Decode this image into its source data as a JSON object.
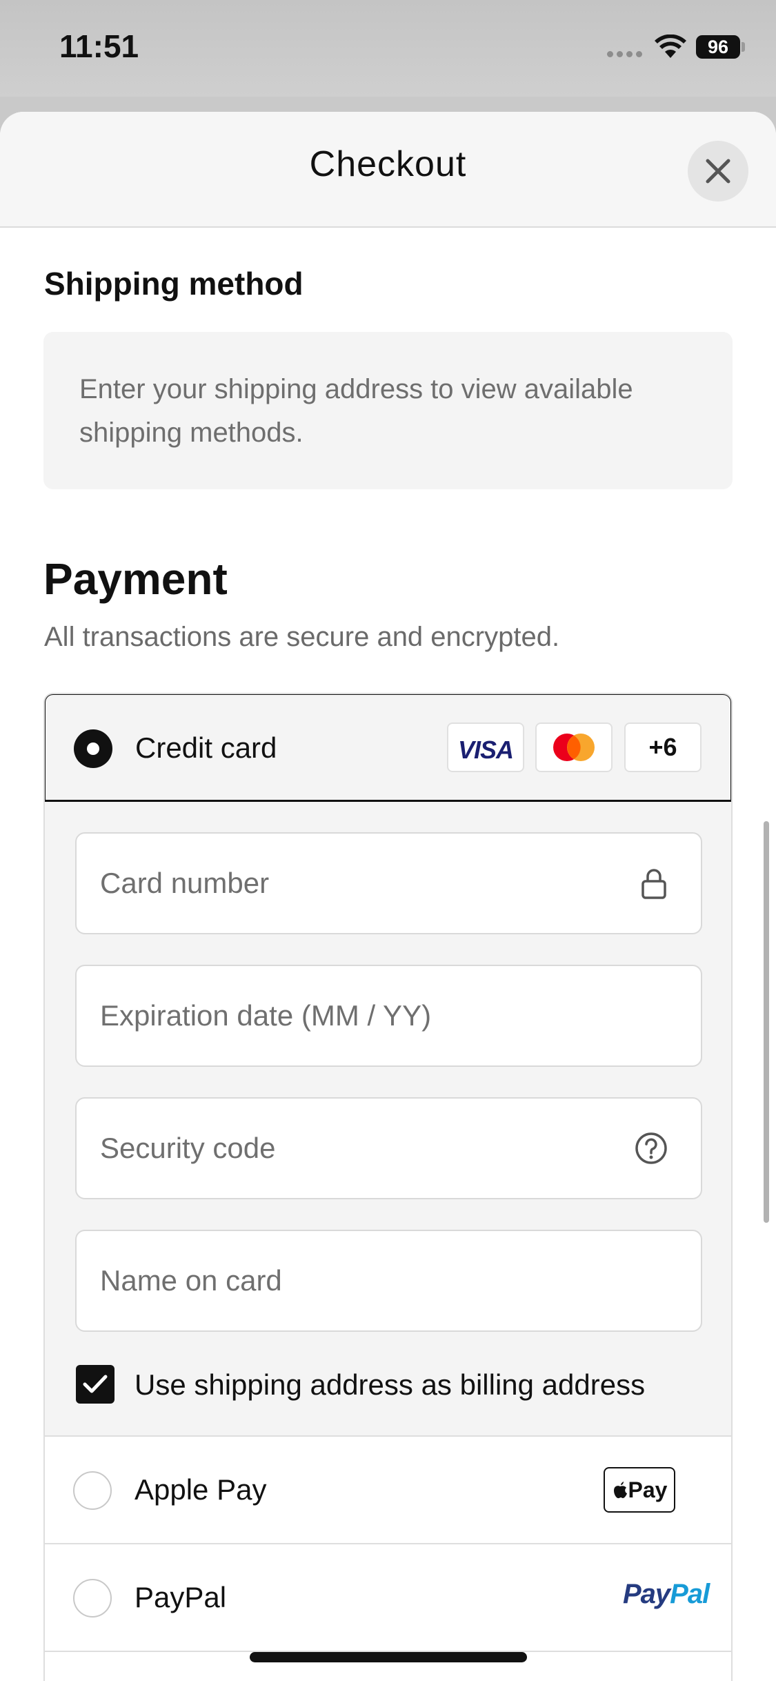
{
  "status_bar": {
    "time": "11:51",
    "battery": "96"
  },
  "header": {
    "title": "Checkout"
  },
  "shipping": {
    "heading": "Shipping method",
    "info_line1": "Enter your shipping address to view available",
    "info_line2": "shipping methods."
  },
  "payment": {
    "heading": "Payment",
    "subtitle": "All transactions are secure and encrypted.",
    "credit_card": {
      "label": "Credit card",
      "selected": true,
      "logos": {
        "visa": "VISA",
        "more": "+6"
      }
    },
    "fields": {
      "card_number": "Card number",
      "expiration": "Expiration date (MM / YY)",
      "security_code": "Security code",
      "name_on_card": "Name on card"
    },
    "billing_checkbox": {
      "label": "Use shipping address as billing address",
      "checked": true
    },
    "apple_pay": {
      "label": "Apple Pay",
      "badge": "Pay"
    },
    "paypal": {
      "label": "PayPal",
      "logo_part1": "Pay",
      "logo_part2": "Pal"
    }
  },
  "colors": {
    "accent": "#111111",
    "visa_blue": "#1a1f71",
    "mastercard_red": "#eb001b",
    "mastercard_orange": "#f79e1b",
    "paypal_dark": "#253b80",
    "paypal_light": "#179bd7"
  },
  "icons": [
    "wifi-icon",
    "close-icon",
    "lock-icon",
    "help-circle-icon",
    "check-icon",
    "apple-icon"
  ]
}
